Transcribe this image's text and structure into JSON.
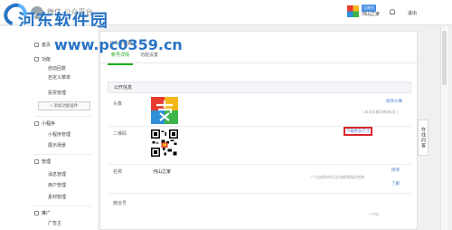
{
  "header": {
    "brand_text": "微信·公众平台",
    "watermark_title": "河东软件园",
    "watermark_url": "www.pc0359.cn",
    "account_badge": "订阅号",
    "account_name": "河山之家",
    "logout_label": "退出"
  },
  "sidebar": {
    "groups": [
      {
        "label": "首页",
        "icon": "home-icon"
      },
      {
        "label": "功能",
        "icon": "function-icon",
        "items": [
          "自动回复",
          "自定义菜单",
          "投票管理"
        ]
      },
      {
        "label": "小程序",
        "icon": "miniprogram-icon",
        "items": [
          "小程序管理",
          "展示场景"
        ]
      },
      {
        "label": "管理",
        "icon": "manage-icon",
        "items": [
          "消息管理",
          "用户管理",
          "素材管理"
        ]
      },
      {
        "label": "推广",
        "icon": "promote-icon",
        "items": [
          "广告主"
        ]
      }
    ],
    "add_plugin_label": "+ 添加功能插件"
  },
  "main": {
    "page_title": "公众号设置",
    "tabs": [
      "帐号详情",
      "功能设置"
    ],
    "section_title": "公开信息",
    "rows": {
      "avatar_label": "头像",
      "avatar_action": "修改头像",
      "avatar_note": "( 本月头像可修改5次 )",
      "qrcode_label": "二维码",
      "qrcode_action": "下载更多尺寸",
      "name_label": "名称",
      "name_value": "河山之家",
      "name_action": "修改",
      "name_note": "一个自然年内可主动修改两次名称",
      "name_note_link": "了解",
      "wechat_id_label": "微信号",
      "wechat_id_note": "一个自"
    }
  },
  "float_tab": {
    "label": "在线问答"
  },
  "colors": {
    "accent": "#1aad19",
    "link": "#4a7ed1",
    "highlight": "#d8262c",
    "watermark": "#2a74c4"
  }
}
